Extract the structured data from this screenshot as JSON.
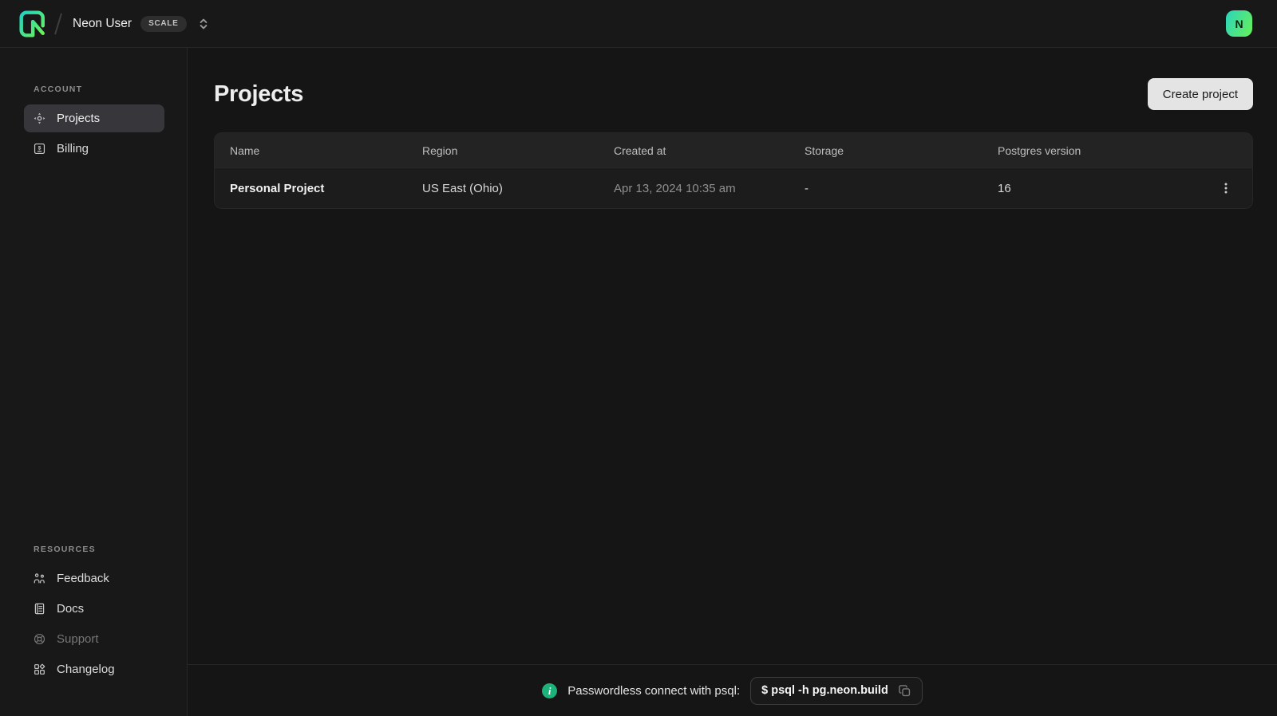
{
  "topbar": {
    "org_name": "Neon User",
    "plan_badge": "SCALE",
    "avatar_letter": "N"
  },
  "sidebar": {
    "sections": [
      {
        "label": "ACCOUNT",
        "items": [
          {
            "label": "Projects",
            "icon": "focus-target",
            "active": true
          },
          {
            "label": "Billing",
            "icon": "dollar-banknote",
            "active": false
          }
        ]
      },
      {
        "label": "RESOURCES",
        "items": [
          {
            "label": "Feedback",
            "icon": "two-people",
            "active": false
          },
          {
            "label": "Docs",
            "icon": "document-lines",
            "active": false
          },
          {
            "label": "Support",
            "icon": "lifebuoy",
            "active": false,
            "dimmed": true
          },
          {
            "label": "Changelog",
            "icon": "grid-squares-diamond",
            "active": false
          }
        ]
      }
    ]
  },
  "main": {
    "title": "Projects",
    "create_button_label": "Create project",
    "table": {
      "columns": [
        "Name",
        "Region",
        "Created at",
        "Storage",
        "Postgres version"
      ],
      "rows": [
        {
          "name": "Personal Project",
          "region": "US East (Ohio)",
          "created_at": "Apr 13, 2024 10:35 am",
          "storage": "-",
          "postgres_version": "16"
        }
      ]
    }
  },
  "footer": {
    "info_label": "Passwordless connect with psql:",
    "command": "$ psql -h pg.neon.build",
    "info_glyph": "i"
  },
  "icons": {
    "logo": "neon-logomark",
    "org_selector": "up-down-chevrons",
    "row_actions": "vertical-kebab-dots",
    "footer_info": "info-circle",
    "footer_copy": "copy-overlapping-squares"
  },
  "colors": {
    "brand_green": "#00e599",
    "avatar_gradient_start": "#2bd4be",
    "avatar_gradient_end": "#68f156",
    "info_icon_green": "#1db279",
    "create_button_bg": "#e4e4e4",
    "active_nav_bg": "#37373b",
    "topbar_bg": "#181818",
    "main_bg": "#151515",
    "table_header_bg": "#232323",
    "table_row_bg": "#1c1c1c",
    "border": "#272727"
  }
}
